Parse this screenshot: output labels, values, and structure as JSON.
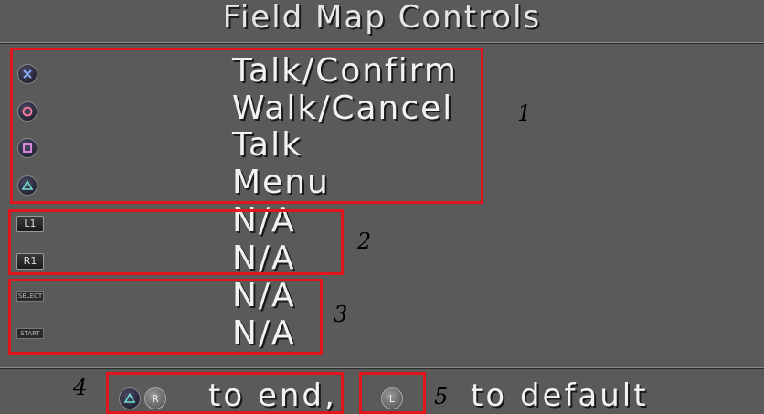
{
  "title": "Field Map Controls",
  "rows": [
    {
      "button": "cross-icon",
      "label": "Talk/Confirm"
    },
    {
      "button": "circle-icon",
      "label": "Walk/Cancel"
    },
    {
      "button": "square-icon",
      "label": "Talk"
    },
    {
      "button": "triangle-icon",
      "label": "Menu"
    },
    {
      "button": "l1-button",
      "button_text": "L1",
      "label": "N/A"
    },
    {
      "button": "r1-button",
      "button_text": "R1",
      "label": "N/A"
    },
    {
      "button": "select-button",
      "button_text": "SELECT",
      "label": "N/A"
    },
    {
      "button": "start-button",
      "button_text": "START",
      "label": "N/A"
    }
  ],
  "annotations": {
    "group1": "1",
    "group2": "2",
    "group3": "3",
    "group4": "4",
    "group5": "5"
  },
  "footer": {
    "end_text": "to end,",
    "default_text": "to default",
    "r_label": "R",
    "l_label": "L"
  },
  "colors": {
    "background": "#5a5a5a",
    "highlight_box": "#e0161c",
    "text": "#f2f2f2"
  }
}
